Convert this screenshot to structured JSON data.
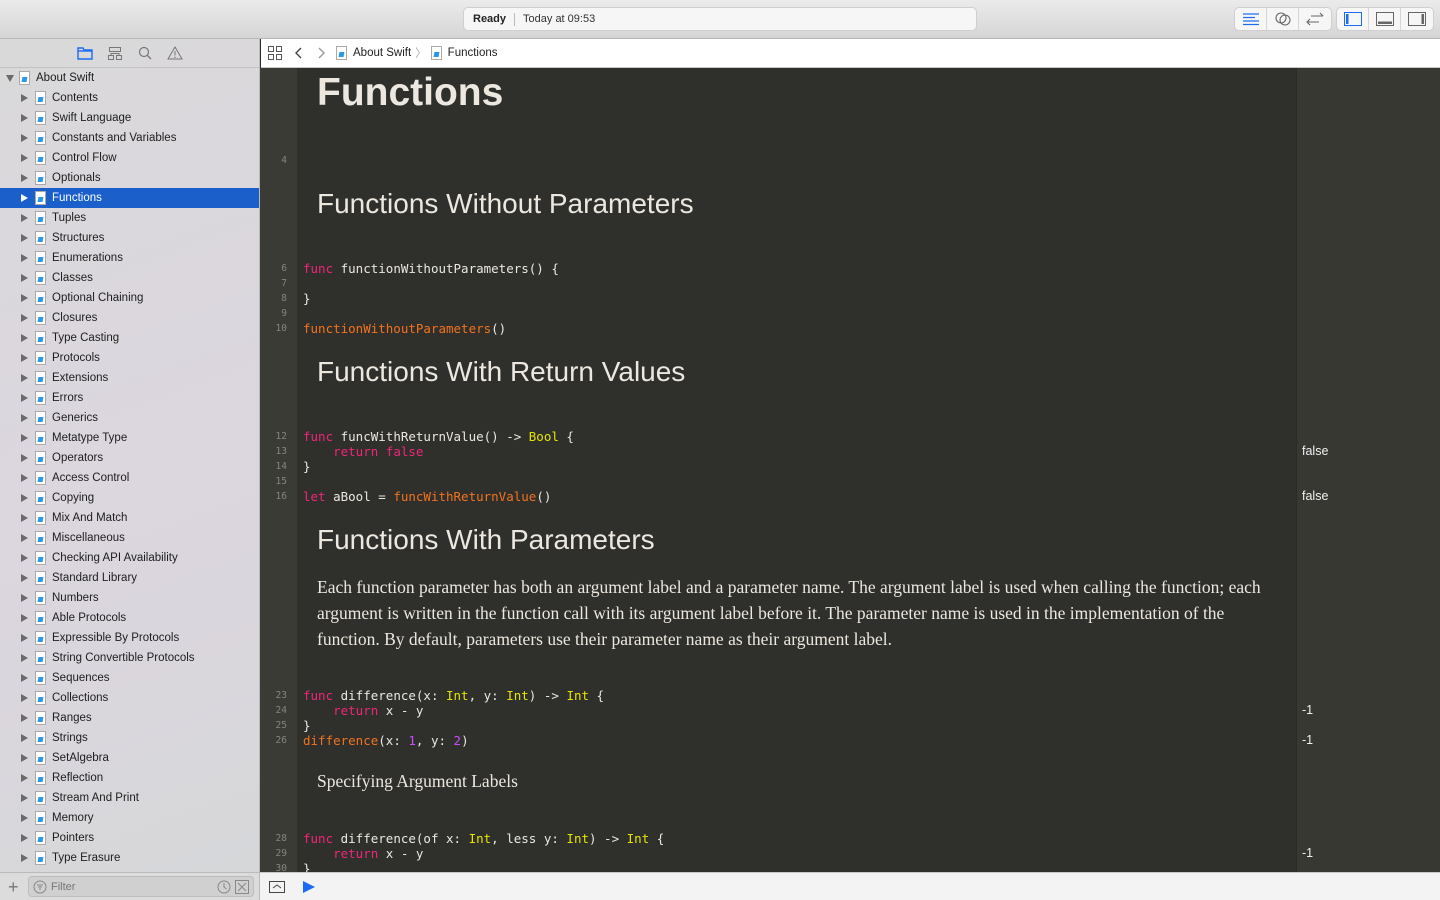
{
  "toolbar": {
    "status": "Ready",
    "timestamp": "Today at 09:53",
    "accent": "#1b6cf2"
  },
  "jumpbar": {
    "crumbs": [
      "About Swift",
      "Functions"
    ]
  },
  "navigator": {
    "root": "About Swift",
    "selected": "Functions",
    "items": [
      "Contents",
      "Swift Language",
      "Constants and Variables",
      "Control Flow",
      "Optionals",
      "Functions",
      "Tuples",
      "Structures",
      "Enumerations",
      "Classes",
      "Optional Chaining",
      "Closures",
      "Type Casting",
      "Protocols",
      "Extensions",
      "Errors",
      "Generics",
      "Metatype Type",
      "Operators",
      "Access Control",
      "Copying",
      "Mix And Match",
      "Miscellaneous",
      "Checking API Availability",
      "Standard Library",
      "Numbers",
      "Able Protocols",
      "Expressible By Protocols",
      "String Convertible Protocols",
      "Sequences",
      "Collections",
      "Ranges",
      "Strings",
      "SetAlgebra",
      "Reflection",
      "Stream And Print",
      "Memory",
      "Pointers",
      "Type Erasure"
    ],
    "filter_placeholder": "Filter"
  },
  "editor": {
    "title": "Functions",
    "headings": [
      "Functions Without Parameters",
      "Functions With Return Values",
      "Functions With Parameters"
    ],
    "paragraph": "Each function parameter has both an argument label and a parameter name. The argument label is used when calling the function; each argument is written in the function call with its argument label before it. The parameter name is used in the implementation of the function. By default, parameters use their parameter name as their argument label.",
    "subheading": "Specifying Argument Labels",
    "lines": [
      {
        "n": "4",
        "tokens": []
      },
      {
        "n": "6",
        "tokens": [
          [
            "k",
            "func"
          ],
          [
            "p",
            " functionWithoutParameters() {"
          ]
        ]
      },
      {
        "n": "7",
        "tokens": []
      },
      {
        "n": "8",
        "tokens": [
          [
            "p",
            "}"
          ]
        ]
      },
      {
        "n": "9",
        "tokens": []
      },
      {
        "n": "10",
        "tokens": [
          [
            "f",
            "functionWithoutParameters"
          ],
          [
            "p",
            "()"
          ]
        ]
      },
      {
        "n": "12",
        "tokens": [
          [
            "k",
            "func"
          ],
          [
            "p",
            " funcWithReturnValue() -> "
          ],
          [
            "t",
            "Bool"
          ],
          [
            "p",
            " {"
          ]
        ]
      },
      {
        "n": "13",
        "tokens": [
          [
            "p",
            "    "
          ],
          [
            "k",
            "return false"
          ]
        ]
      },
      {
        "n": "14",
        "tokens": [
          [
            "p",
            "}"
          ]
        ]
      },
      {
        "n": "15",
        "tokens": []
      },
      {
        "n": "16",
        "tokens": [
          [
            "k",
            "let"
          ],
          [
            "p",
            " aBool = "
          ],
          [
            "f",
            "funcWithReturnValue"
          ],
          [
            "p",
            "()"
          ]
        ]
      },
      {
        "n": "23",
        "tokens": [
          [
            "k",
            "func"
          ],
          [
            "p",
            " difference(x: "
          ],
          [
            "t",
            "Int"
          ],
          [
            "p",
            ", y: "
          ],
          [
            "t",
            "Int"
          ],
          [
            "p",
            ") -> "
          ],
          [
            "t",
            "Int"
          ],
          [
            "p",
            " {"
          ]
        ]
      },
      {
        "n": "24",
        "tokens": [
          [
            "p",
            "    "
          ],
          [
            "k",
            "return"
          ],
          [
            "p",
            " x - y"
          ]
        ]
      },
      {
        "n": "25",
        "tokens": [
          [
            "p",
            "}"
          ]
        ]
      },
      {
        "n": "26",
        "tokens": [
          [
            "f",
            "difference"
          ],
          [
            "p",
            "(x: "
          ],
          [
            "n",
            "1"
          ],
          [
            "p",
            ", y: "
          ],
          [
            "n",
            "2"
          ],
          [
            "p",
            ")"
          ]
        ]
      },
      {
        "n": "28",
        "tokens": [
          [
            "k",
            "func"
          ],
          [
            "p",
            " difference(of x: "
          ],
          [
            "t",
            "Int"
          ],
          [
            "p",
            ", less y: "
          ],
          [
            "t",
            "Int"
          ],
          [
            "p",
            ") -> "
          ],
          [
            "t",
            "Int"
          ],
          [
            "p",
            " {"
          ]
        ]
      },
      {
        "n": "29",
        "tokens": [
          [
            "p",
            "    "
          ],
          [
            "k",
            "return"
          ],
          [
            "p",
            " x - y"
          ]
        ]
      },
      {
        "n": "30",
        "tokens": [
          [
            "p",
            "}"
          ]
        ]
      }
    ],
    "results": [
      "false",
      "false",
      "-1",
      "-1",
      "-1"
    ],
    "colors": {
      "keyword": "#f0257a",
      "function": "#f2731e",
      "type": "#e6e400",
      "number": "#c64dff"
    }
  }
}
